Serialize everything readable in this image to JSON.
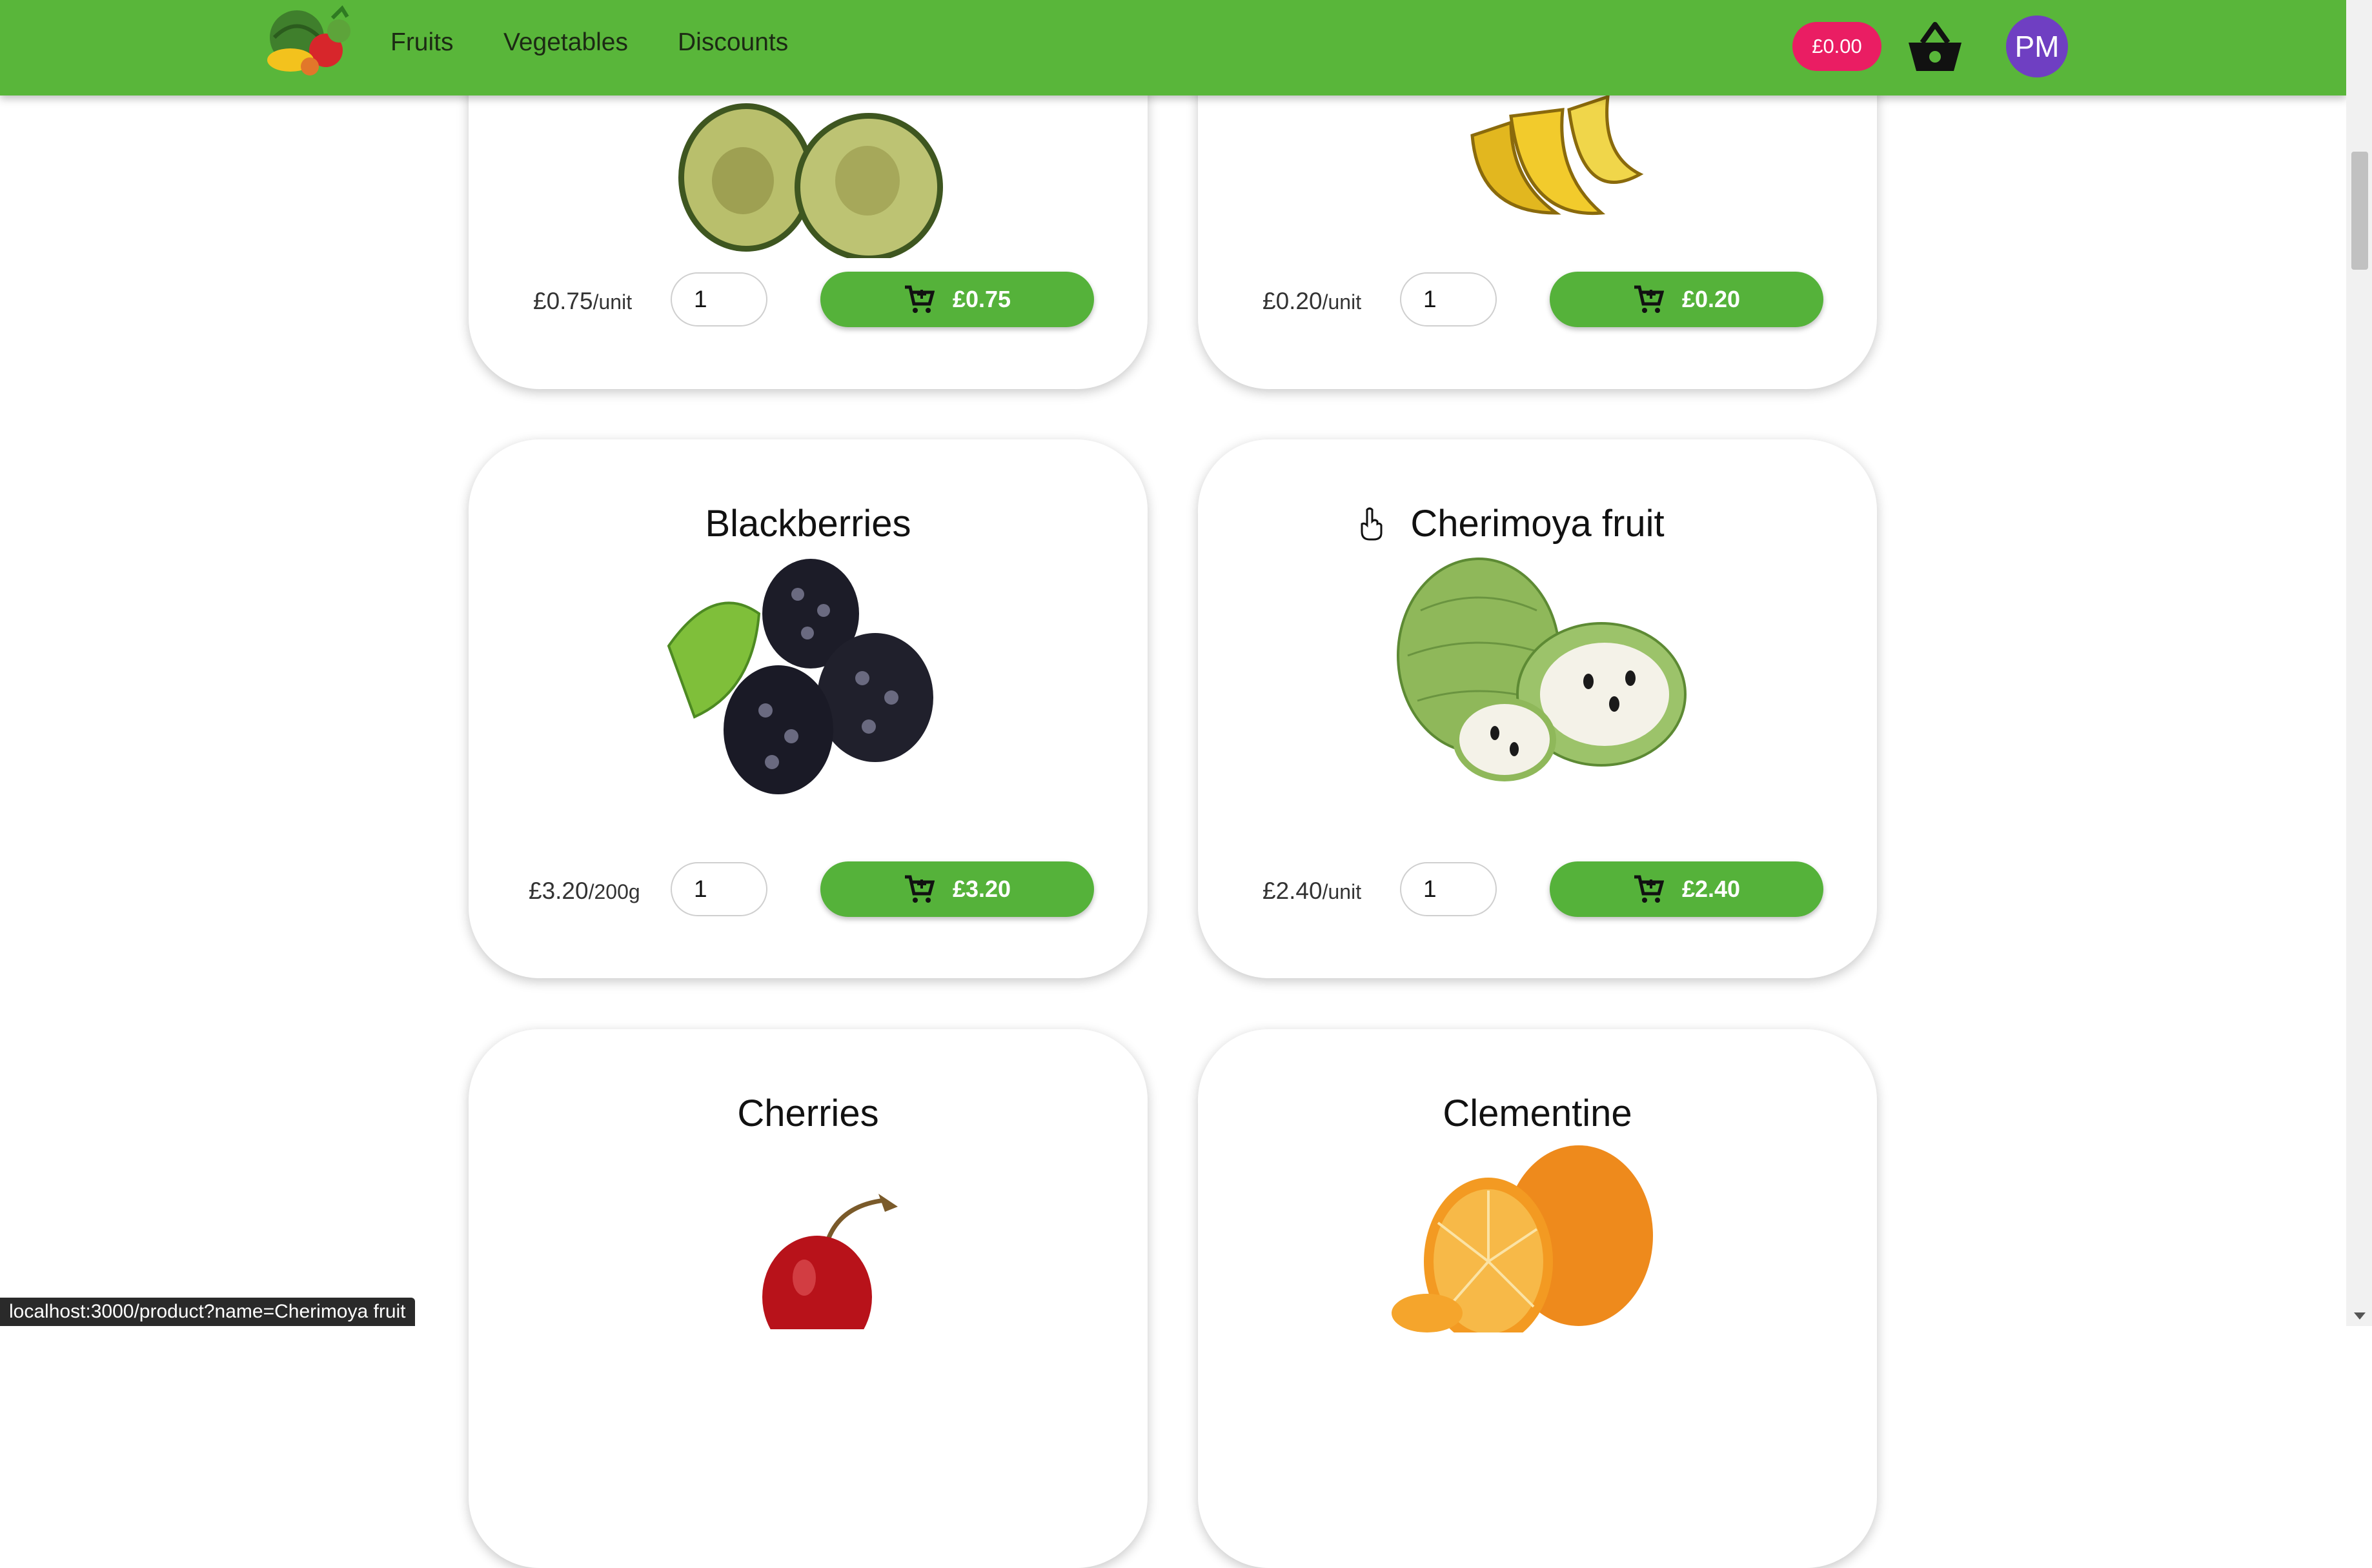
{
  "nav": {
    "links": [
      "Fruits",
      "Vegetables",
      "Discounts"
    ],
    "cart_total": "£0.00",
    "avatar_initials": "PM"
  },
  "colors": {
    "navbar": "#59b63a",
    "cart_badge": "#ea1d63",
    "avatar": "#6f3fc2",
    "button": "#55b23a"
  },
  "products": [
    {
      "name": "",
      "price": "£0.75",
      "unit": "/unit",
      "qty": "1",
      "button_label": "£0.75",
      "image": "avocado"
    },
    {
      "name": "",
      "price": "£0.20",
      "unit": "/unit",
      "qty": "1",
      "button_label": "£0.20",
      "image": "banana"
    },
    {
      "name": "Blackberries",
      "price": "£3.20",
      "unit": "/200g",
      "qty": "1",
      "button_label": "£3.20",
      "image": "blackberries"
    },
    {
      "name": "Cherimoya fruit",
      "price": "£2.40",
      "unit": "/unit",
      "qty": "1",
      "button_label": "£2.40",
      "image": "cherimoya"
    },
    {
      "name": "Cherries",
      "image": "cherry"
    },
    {
      "name": "Clementine",
      "image": "clementine"
    }
  ],
  "status_url": "localhost:3000/product?name=Cherimoya fruit"
}
